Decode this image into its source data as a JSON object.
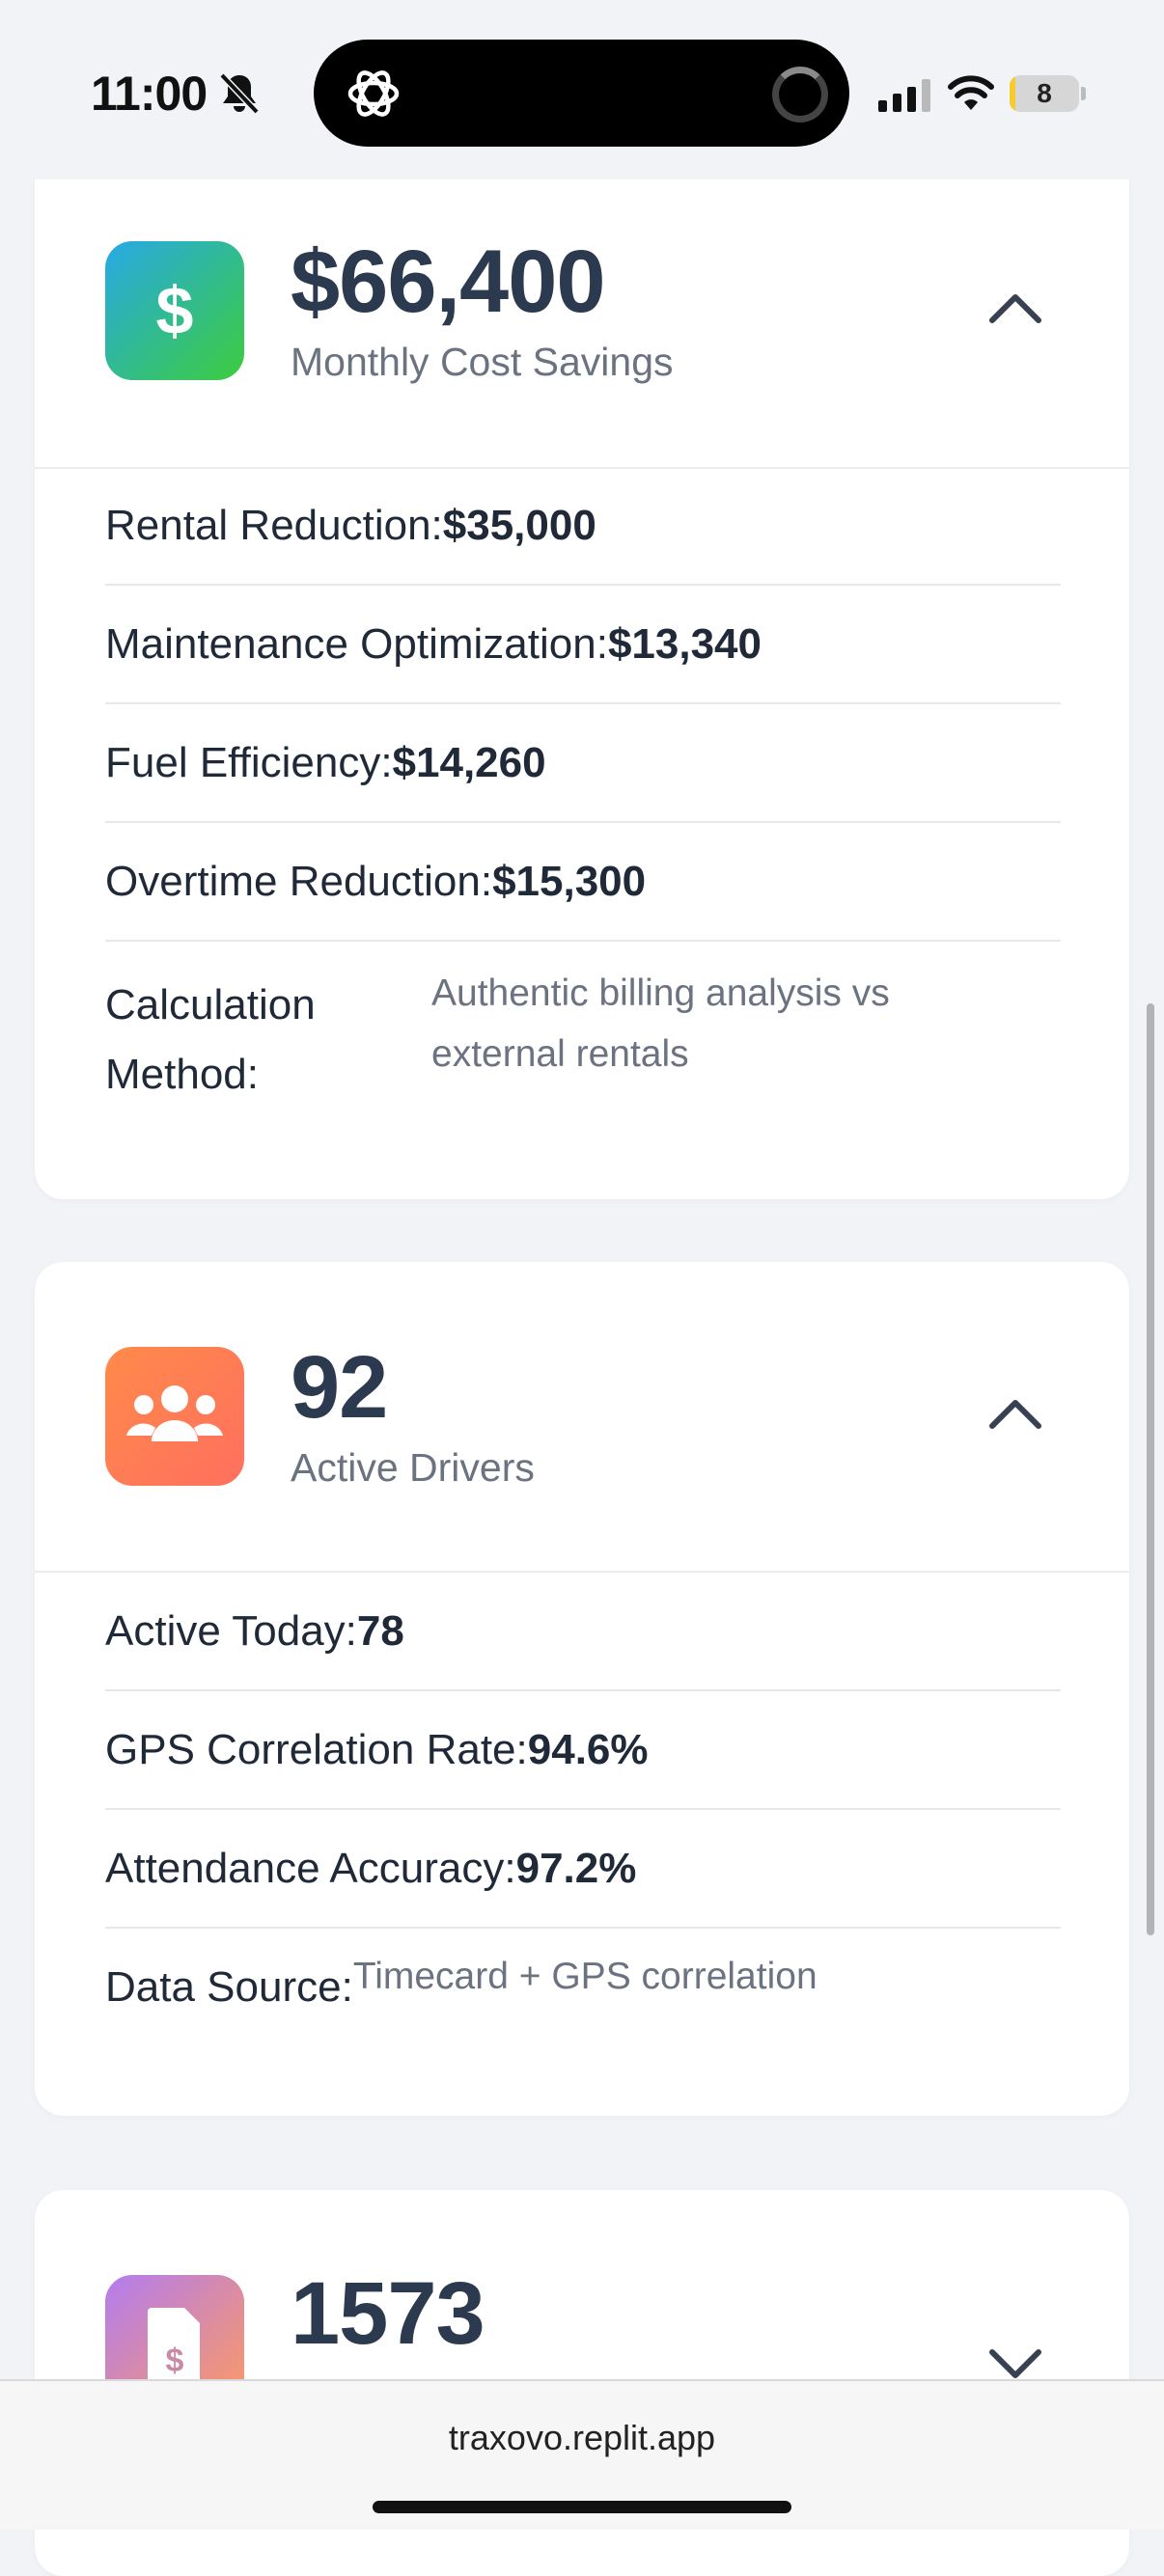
{
  "status_bar": {
    "time": "11:00",
    "battery_level": "8",
    "battery_fraction": 0.08
  },
  "cards": {
    "cost_savings": {
      "icon": "dollar-sign-icon",
      "value": "$66,400",
      "label": "Monthly Cost Savings",
      "expanded": true,
      "rows": [
        {
          "key": "Rental Reduction:",
          "value": "$35,000"
        },
        {
          "key": "Maintenance Optimization:",
          "value": "$13,340"
        },
        {
          "key": "Fuel Efficiency:",
          "value": "$14,260"
        },
        {
          "key": "Overtime Reduction:",
          "value": "$15,300"
        }
      ],
      "method_key": "Calculation Method:",
      "method_value": "Authentic billing analysis vs external rentals",
      "colors": {
        "icon_gradient_start": "#27a9e6",
        "icon_gradient_end": "#3dcc3d"
      }
    },
    "drivers": {
      "icon": "users-icon",
      "value": "92",
      "label": "Active Drivers",
      "expanded": true,
      "rows": [
        {
          "key": "Active Today:",
          "value": "78"
        },
        {
          "key": "GPS Correlation Rate:",
          "value": "94.6%"
        },
        {
          "key": "Attendance Accuracy:",
          "value": "97.2%"
        }
      ],
      "source_key": "Data Source:",
      "source_value": "Timecard + GPS correlation",
      "colors": {
        "icon_gradient_start": "#ff8a4a",
        "icon_gradient_end": "#ff6f5e"
      }
    },
    "invoices": {
      "icon": "invoice-dollar-icon",
      "value": "1573",
      "expanded": false,
      "colors": {
        "icon_gradient_start": "#b27cf0",
        "icon_gradient_end": "#ff9a5e"
      }
    }
  },
  "browser": {
    "url": "traxovo.replit.app"
  }
}
